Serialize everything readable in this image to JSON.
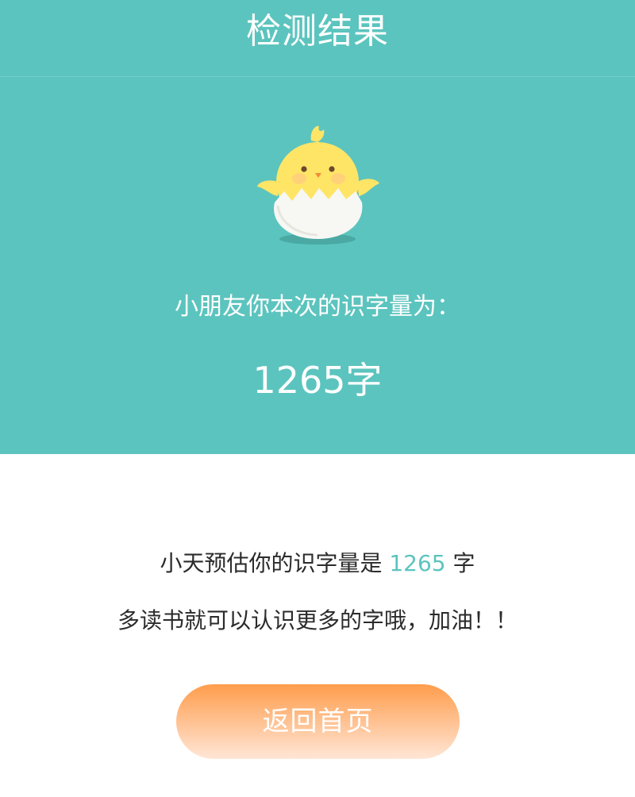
{
  "header": {
    "title": "检测结果"
  },
  "result": {
    "mascot_icon": "chick-in-egg-icon",
    "label": "小朋友你本次的识字量为：",
    "count_text": "1265字"
  },
  "summary": {
    "estimate_prefix": "小天预估你的识字量是 ",
    "estimate_value": "1265",
    "estimate_suffix": " 字",
    "encouragement": "多读书就可以认识更多的字哦，加油！！"
  },
  "actions": {
    "home_label": "返回首页"
  },
  "colors": {
    "accent": "#5cc4be",
    "button_top": "#ff9d4c",
    "button_bottom": "#ffe6d6",
    "text_dark": "#2b2b2b"
  }
}
